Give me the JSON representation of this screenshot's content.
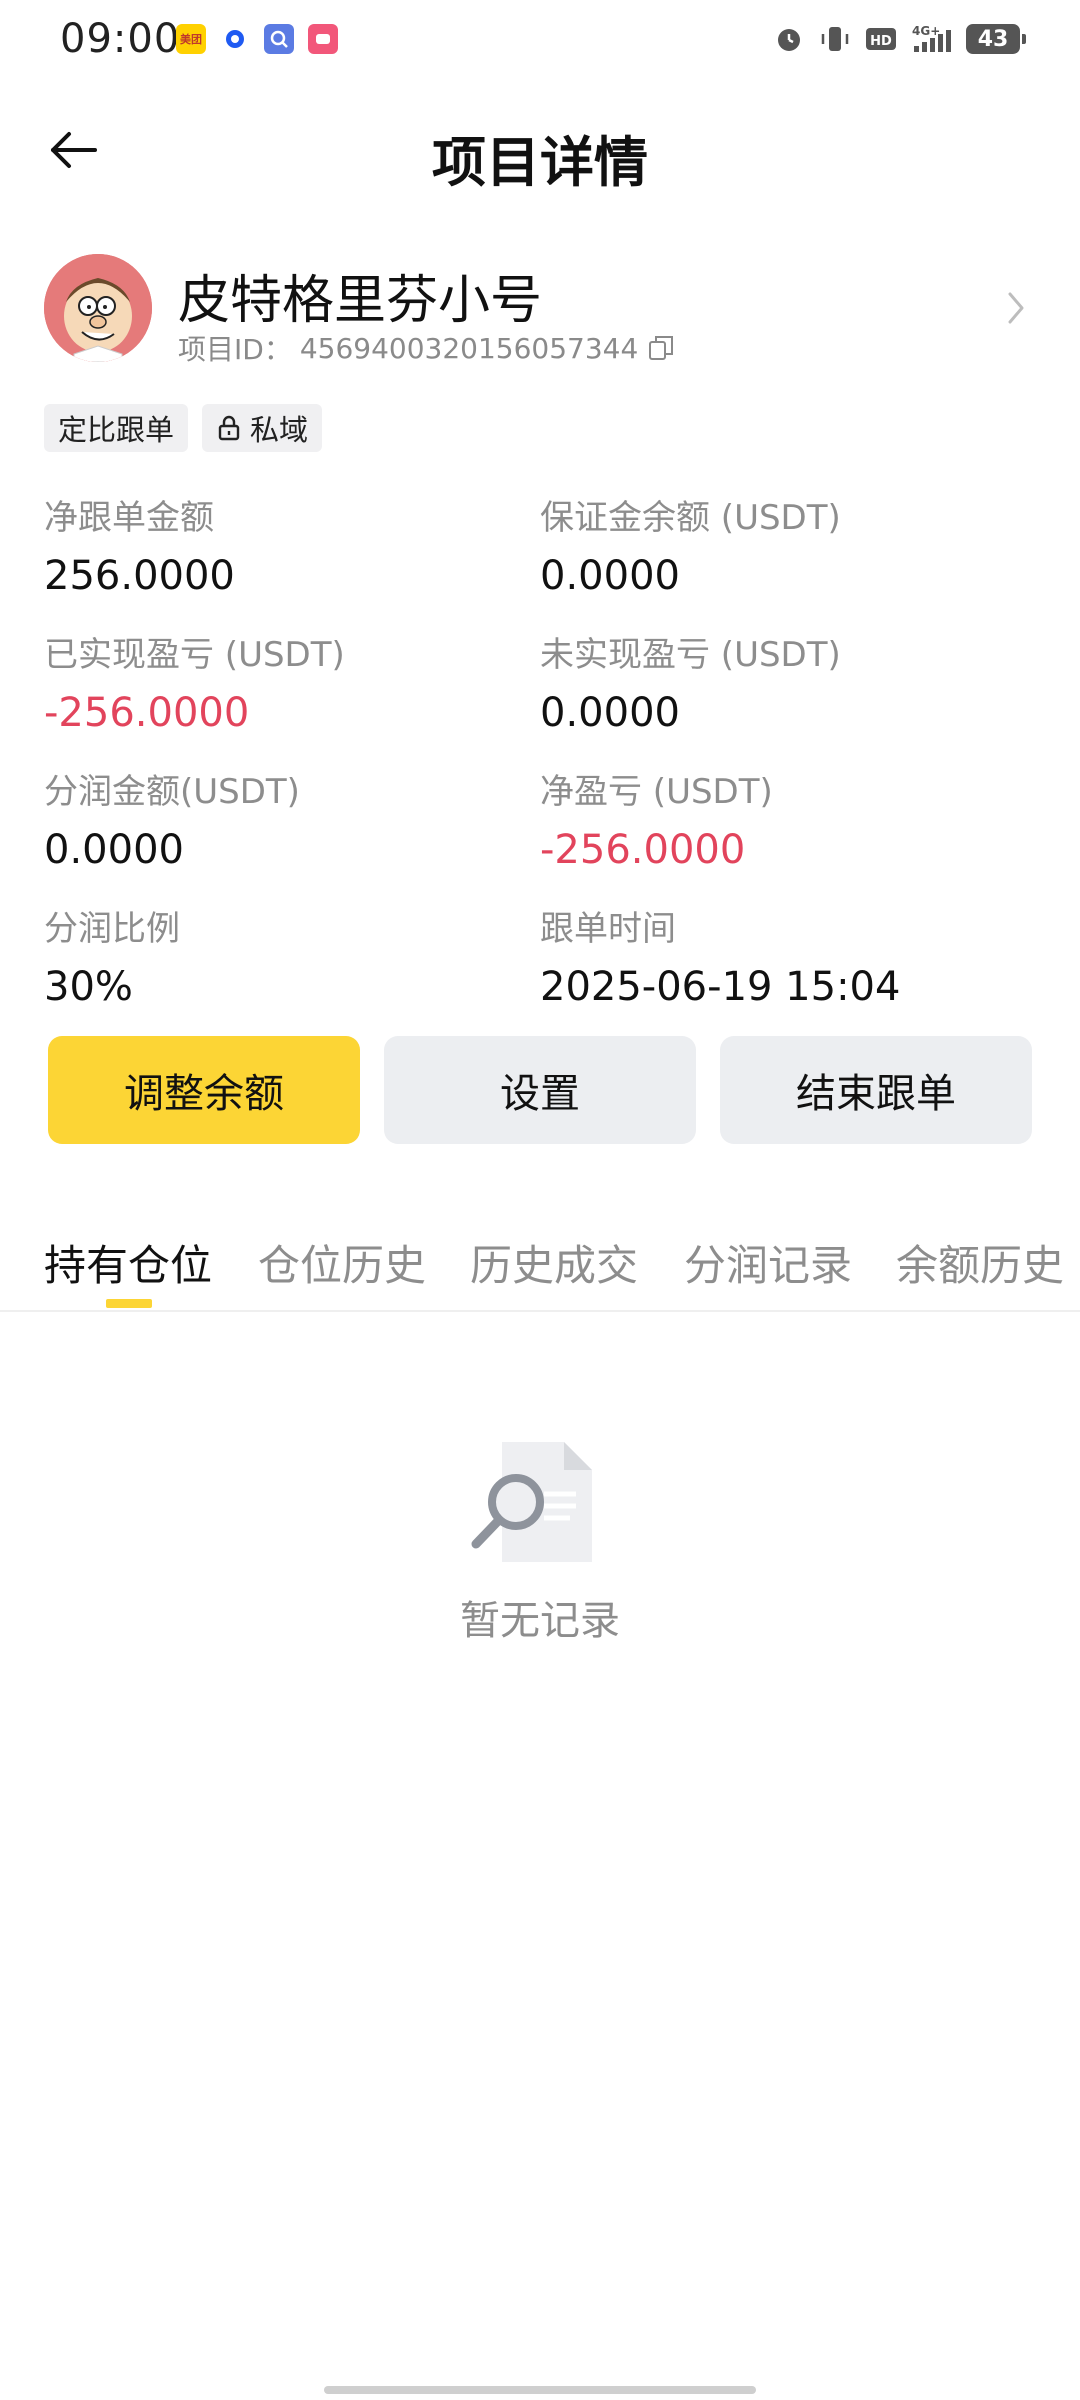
{
  "status_bar": {
    "time": "09:00",
    "apps": [
      {
        "name": "meituan-icon",
        "text": "美团",
        "color": "#ffd100"
      },
      {
        "name": "app-blue-icon",
        "text": "",
        "color": "#1f5af2"
      },
      {
        "name": "app-search-icon",
        "text": "",
        "color": "#5b7be3"
      },
      {
        "name": "app-pink-icon",
        "text": "",
        "color": "#f2577a"
      }
    ],
    "battery": "43"
  },
  "header": {
    "title": "项目详情"
  },
  "profile": {
    "name": "皮特格里芬小号",
    "id_label": "项目ID：",
    "id_value": "4569400320156057344"
  },
  "tags": [
    {
      "label": "定比跟单"
    },
    {
      "label": "私域"
    }
  ],
  "stats": [
    {
      "label": "净跟单金额",
      "value": "256.0000",
      "negative": false
    },
    {
      "label": "保证金余额 (USDT)",
      "value": "0.0000",
      "negative": false
    },
    {
      "label": "已实现盈亏 (USDT)",
      "value": "-256.0000",
      "negative": true
    },
    {
      "label": "未实现盈亏 (USDT)",
      "value": "0.0000",
      "negative": false
    },
    {
      "label": "分润金额(USDT)",
      "value": "0.0000",
      "negative": false
    },
    {
      "label": "净盈亏 (USDT)",
      "value": "-256.0000",
      "negative": true
    },
    {
      "label": "分润比例",
      "value": "30%",
      "negative": false
    },
    {
      "label": "跟单时间",
      "value": "2025-06-19 15:04",
      "negative": false
    }
  ],
  "actions": {
    "adjust_balance": "调整余额",
    "settings": "设置",
    "end_follow": "结束跟单"
  },
  "tabs": [
    {
      "label": "持有仓位",
      "active": true
    },
    {
      "label": "仓位历史",
      "active": false
    },
    {
      "label": "历史成交",
      "active": false
    },
    {
      "label": "分润记录",
      "active": false
    },
    {
      "label": "余额历史",
      "active": false
    }
  ],
  "empty_state": {
    "text": "暂无记录"
  },
  "colors": {
    "accent": "#fcd535",
    "negative": "#e2445c",
    "secondary_text": "#8d8d8d"
  }
}
